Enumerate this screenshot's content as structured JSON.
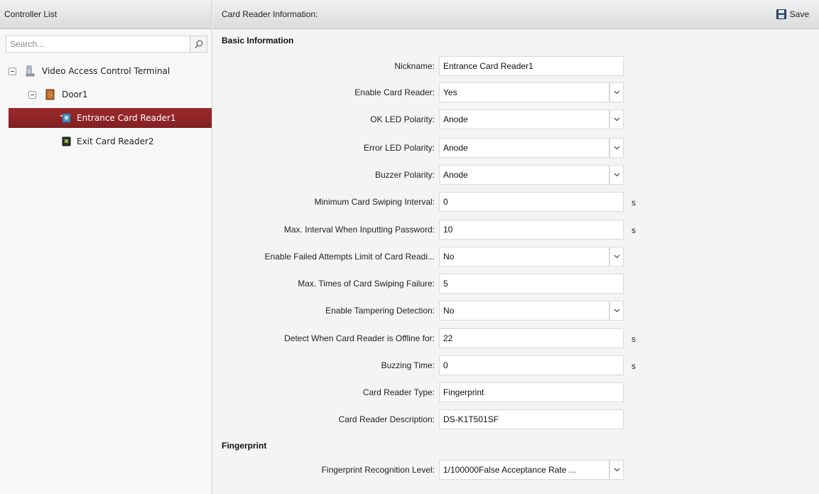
{
  "left_panel": {
    "title": "Controller List",
    "search": {
      "placeholder": "Search...",
      "value": ""
    },
    "tree": [
      {
        "label": "Video Access Control Terminal",
        "icon": "terminal-icon",
        "level": 0,
        "expanded": true
      },
      {
        "label": "Door1",
        "icon": "door-icon",
        "level": 1,
        "expanded": true
      },
      {
        "label": "Entrance Card Reader1",
        "icon": "card-reader-icon",
        "level": 2,
        "selected": true
      },
      {
        "label": "Exit Card Reader2",
        "icon": "card-reader-icon",
        "level": 2,
        "selected": false
      }
    ]
  },
  "right_panel": {
    "title": "Card Reader Information:",
    "save_label": "Save",
    "sections": {
      "basic": "Basic Information",
      "fingerprint": "Fingerprint"
    },
    "fields": [
      {
        "label": "Nickname:",
        "value": "Entrance Card Reader1",
        "type": "text"
      },
      {
        "label": "Enable Card Reader:",
        "value": "Yes",
        "type": "select"
      },
      {
        "label": "OK LED Polarity:",
        "value": "Anode",
        "type": "select"
      },
      {
        "label": "Error LED Polarity:",
        "value": "Anode",
        "type": "select"
      },
      {
        "label": "Buzzer Polarity:",
        "value": "Anode",
        "type": "select"
      },
      {
        "label": "Minimum Card Swiping Interval:",
        "value": "0",
        "type": "text",
        "unit": "s"
      },
      {
        "label": "Max. Interval When Inputting Password:",
        "value": "10",
        "type": "text",
        "unit": "s"
      },
      {
        "label": "Enable Failed Attempts Limit of Card Readi...",
        "value": "No",
        "type": "select"
      },
      {
        "label": "Max. Times of Card Swiping Failure:",
        "value": "5",
        "type": "text"
      },
      {
        "label": "Enable Tampering Detection:",
        "value": "No",
        "type": "select"
      },
      {
        "label": "Detect When Card Reader is Offline for:",
        "value": "22",
        "type": "text",
        "unit": "s"
      },
      {
        "label": "Buzzing Time:",
        "value": "0",
        "type": "text",
        "unit": "s"
      },
      {
        "label": "Card Reader Type:",
        "value": "Fingerprint",
        "type": "text"
      },
      {
        "label": "Card Reader Description:",
        "value": "DS-K1T501SF",
        "type": "text"
      }
    ],
    "fingerprint_fields": [
      {
        "label": "Fingerprint Recognition Level:",
        "value": "1/100000False Acceptance Rate ...",
        "type": "select"
      }
    ]
  },
  "colors": {
    "selected_row": "#8f2528",
    "header_bg": "#e6e6e6",
    "panel_bg": "#f4f4f4"
  }
}
